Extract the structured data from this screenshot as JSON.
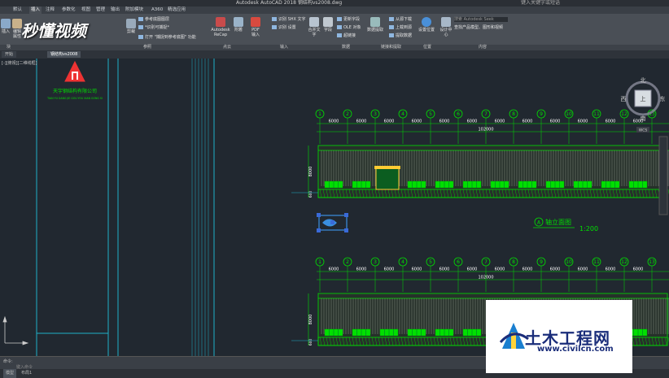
{
  "titlebar": {
    "title": "Autodesk AutoCAD 2018   钢结构vs2008.dwg",
    "search": "键入关键字或短语"
  },
  "menu_tabs": [
    "默认",
    "插入",
    "注释",
    "参数化",
    "视图",
    "管理",
    "输出",
    "附加模块",
    "A360",
    "精选应用"
  ],
  "ribbon": {
    "insert_label": "插入",
    "edit_label": "编辑属性",
    "ref_items": [
      "参考底图图层",
      "*识别可捕捉*",
      "打开 \"捕捉到参考底图\" 功能"
    ],
    "clip_label": "剪裁",
    "adjust_label": "调整",
    "recap_label": "Autodesk ReCap",
    "attach_label": "附着",
    "pdf_label": "PDF 输入",
    "recog_items": [
      "识别 SHX 文字",
      "识别 设置"
    ],
    "merge_label": "合并文字",
    "field_label": "字段",
    "data_items": [
      "更新字段",
      "OLE 对象",
      "超链接"
    ],
    "extract_label": "数据提取",
    "link_items": [
      "从源下载",
      "上载到源",
      "提取数据"
    ],
    "location_label": "设置位置",
    "design_label": "设计中心",
    "content_search": "搜索 Autodesk Seek",
    "content_desc": "查找产品模型、图形和视频"
  },
  "panels": [
    "块",
    "参照",
    "点云",
    "输入",
    "数据",
    "链接和提取",
    "位置",
    "内容"
  ],
  "doc_tabs": [
    "开始",
    "钢结构vs2008"
  ],
  "viewport_label": "[-][俯视][二维线框]",
  "viewcube": {
    "north": "北",
    "south": "南",
    "west": "西",
    "east": "东",
    "top": "上",
    "wcs": "WCS"
  },
  "company": {
    "name": "天宇钢结构有限公司",
    "sub": "TIAN YU GANG JIE GOU YOU XIAN GONG SI"
  },
  "drawing": {
    "axes_top": [
      "1",
      "2",
      "3",
      "4",
      "5",
      "6",
      "7",
      "8",
      "9",
      "10",
      "11",
      "12",
      "13"
    ],
    "axes_bottom": [
      "1",
      "2",
      "3",
      "4",
      "5",
      "6",
      "7",
      "8",
      "9",
      "10",
      "11",
      "12",
      "13"
    ],
    "span": "6000",
    "total": "102000",
    "height_dim": "8000",
    "base_dim": "600",
    "elev_title": "轴立面图",
    "elev_mark": "A",
    "scale": "1:200"
  },
  "cmd": {
    "prompt": "命令:",
    "input": "键入命令"
  },
  "status": {
    "model": "模型",
    "layout": "布局1"
  },
  "watermark_top": "秒懂视频",
  "watermark_brand": "土木工程网",
  "watermark_url": "www.civilcn.com",
  "colors": {
    "accent": "#00e000",
    "frame": "#1fb0c8",
    "bg": "#212830"
  }
}
